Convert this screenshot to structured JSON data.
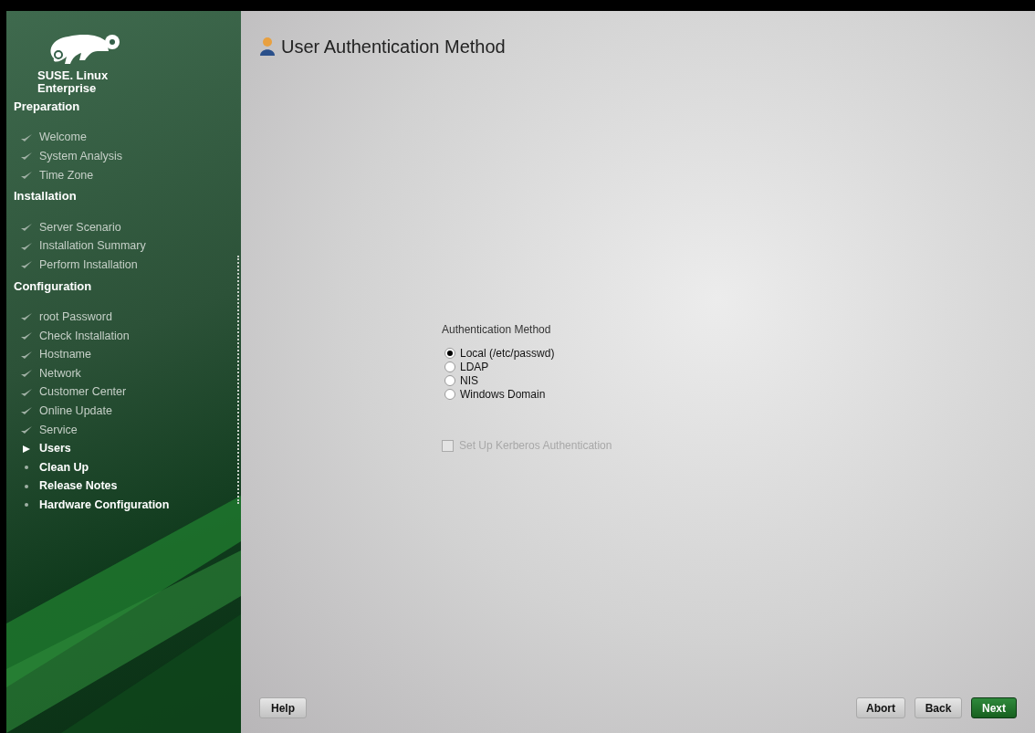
{
  "sidebar": {
    "product": [
      "SUSE. Linux",
      "Enterprise"
    ],
    "sections": [
      {
        "title": "Preparation",
        "steps": [
          {
            "label": "Welcome",
            "kind": "done"
          },
          {
            "label": "System Analysis",
            "kind": "done"
          },
          {
            "label": "Time Zone",
            "kind": "done"
          }
        ]
      },
      {
        "title": "Installation",
        "steps": [
          {
            "label": "Server Scenario",
            "kind": "done"
          },
          {
            "label": "Installation Summary",
            "kind": "done"
          },
          {
            "label": "Perform Installation",
            "kind": "done"
          }
        ]
      },
      {
        "title": "Configuration",
        "steps": [
          {
            "label": "root Password",
            "kind": "done"
          },
          {
            "label": "Check Installation",
            "kind": "done"
          },
          {
            "label": "Hostname",
            "kind": "done"
          },
          {
            "label": "Network",
            "kind": "done"
          },
          {
            "label": "Customer Center",
            "kind": "done"
          },
          {
            "label": "Online Update",
            "kind": "done"
          },
          {
            "label": "Service",
            "kind": "done"
          },
          {
            "label": "Users",
            "kind": "current"
          },
          {
            "label": "Clean Up",
            "kind": "todo"
          },
          {
            "label": "Release Notes",
            "kind": "todo"
          },
          {
            "label": "Hardware Configuration",
            "kind": "todo"
          }
        ]
      }
    ]
  },
  "page_title": "User Authentication Method",
  "method_group": {
    "label": "Authentication Method",
    "options": [
      {
        "label": "Local (/etc/passwd)",
        "selected": true
      },
      {
        "label": "LDAP",
        "selected": false
      },
      {
        "label": "NIS",
        "selected": false
      },
      {
        "label": "Windows Domain",
        "selected": false
      }
    ]
  },
  "kerberos": {
    "label": "Set Up Kerberos Authentication",
    "checked": false,
    "disabled": true
  },
  "buttons": [
    {
      "label": "Help",
      "kind": "plain"
    },
    {
      "label": "Abort",
      "kind": "plain"
    },
    {
      "label": "Back",
      "kind": "plain"
    },
    {
      "label": "Next",
      "kind": "primary"
    }
  ]
}
